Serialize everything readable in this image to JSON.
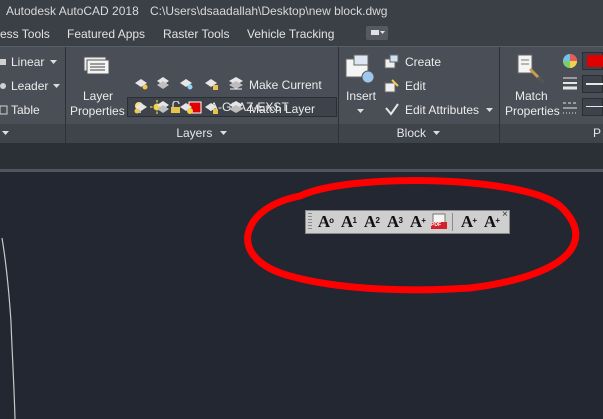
{
  "window": {
    "app": "Autodesk AutoCAD 2018",
    "path": "C:\\Users\\dsaadallah\\Desktop\\new block.dwg"
  },
  "tabs": [
    "ess Tools",
    "Featured Apps",
    "Raster Tools",
    "Vehicle Tracking"
  ],
  "annotation_panel": {
    "linear": "Linear",
    "leader": "Leader",
    "table": "Table"
  },
  "layers_panel": {
    "layer_properties_line1": "Layer",
    "layer_properties_line2": "Properties",
    "current_layer": "A-GLAZ-EXST",
    "make_current": "Make Current",
    "match_layer": "Match Layer",
    "title": "Layers"
  },
  "block_panel": {
    "insert": "Insert",
    "create": "Create",
    "edit": "Edit",
    "edit_attributes": "Edit Attributes",
    "title": "Block"
  },
  "properties_panel": {
    "match_line1": "Match",
    "match_line2": "Properties",
    "title_partial": "P"
  },
  "floating_toolbar": {
    "buttons": [
      {
        "letter": "A",
        "sup": "o"
      },
      {
        "letter": "A",
        "sup": "1"
      },
      {
        "letter": "A",
        "sup": "2"
      },
      {
        "letter": "A",
        "sup": "3"
      },
      {
        "letter": "A",
        "sup": "+"
      },
      {
        "letter": "PDF",
        "sup": ""
      },
      {
        "letter": "A",
        "sup": "+"
      },
      {
        "letter": "A",
        "sup": "+"
      }
    ],
    "close": "×"
  },
  "colors": {
    "layer_swatch": "#e00000",
    "highlight": "#ff0000"
  }
}
